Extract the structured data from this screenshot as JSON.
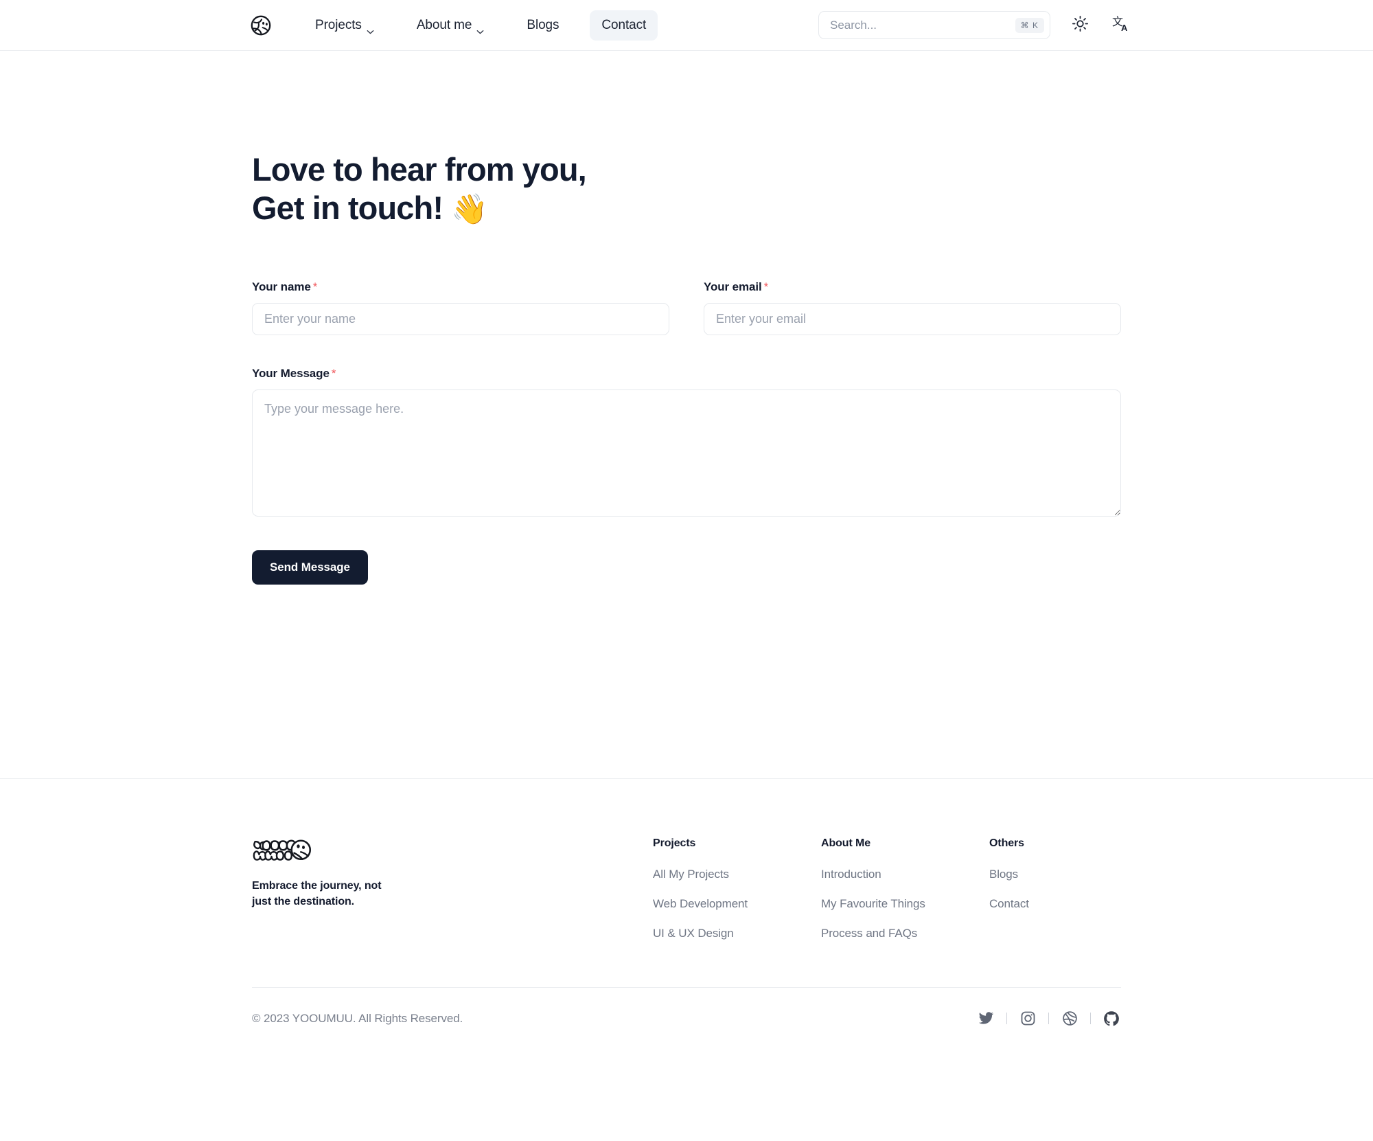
{
  "header": {
    "logo_alt": "YOOUMUU logo",
    "nav": [
      {
        "label": "Projects",
        "has_chevron": true,
        "active": false
      },
      {
        "label": "About me",
        "has_chevron": true,
        "active": false
      },
      {
        "label": "Blogs",
        "has_chevron": false,
        "active": false
      },
      {
        "label": "Contact",
        "has_chevron": false,
        "active": true
      }
    ],
    "search": {
      "placeholder": "Search...",
      "value": "",
      "shortcut": "⌘ K"
    },
    "theme_toggle_icon": "sun-icon",
    "language_toggle_icon": "translate-icon"
  },
  "hero": {
    "line1": "Love to hear from you,",
    "line2": "Get in touch!",
    "emoji": "👋"
  },
  "form": {
    "name": {
      "label": "Your name",
      "required_mark": "*",
      "placeholder": "Enter your name",
      "value": ""
    },
    "email": {
      "label": "Your email",
      "required_mark": "*",
      "placeholder": "Enter your email",
      "value": ""
    },
    "message": {
      "label": "Your Message",
      "required_mark": "*",
      "placeholder": "Type your message here.",
      "value": ""
    },
    "submit_label": "Send Message"
  },
  "footer": {
    "brand": {
      "wordmark": "YOOUMUU",
      "tagline_line1": "Embrace the journey, not",
      "tagline_line2": "just the destination."
    },
    "columns": [
      {
        "title": "Projects",
        "links": [
          "All My Projects",
          "Web Development",
          "UI & UX Design"
        ]
      },
      {
        "title": "About Me",
        "links": [
          "Introduction",
          "My Favourite Things",
          "Process and FAQs"
        ]
      },
      {
        "title": "Others",
        "links": [
          "Blogs",
          "Contact"
        ]
      }
    ],
    "copyright": "© 2023 YOOUMUU. All Rights Reserved.",
    "socials": [
      "twitter-icon",
      "instagram-icon",
      "dribbble-icon",
      "github-icon"
    ]
  },
  "colors": {
    "text_dark": "#131c30",
    "text_muted": "#6f7684",
    "accent_required": "#f0565b",
    "button_bg": "#131c30",
    "active_nav_bg": "#f1f4f8",
    "border": "#e6e9ed"
  }
}
